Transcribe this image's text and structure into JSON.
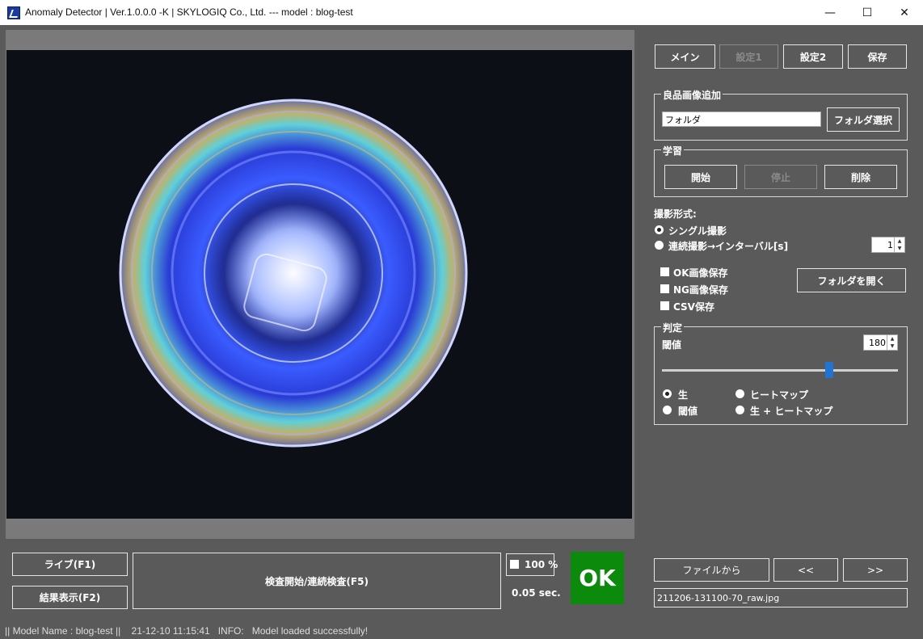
{
  "window": {
    "title": "Anomaly Detector | Ver.1.0.0.0 -K | SKYLOGIQ Co., Ltd. --- model : blog-test",
    "minimize": "—",
    "maximize": "☐",
    "close": "✕"
  },
  "top_buttons": {
    "main": "メイン",
    "settings1": "設定1",
    "settings2": "設定2",
    "save": "保存"
  },
  "good_image_add": {
    "title": "良品画像追加",
    "folder_value": "フォルダ",
    "select_folder": "フォルダ選択"
  },
  "learning": {
    "title": "学習",
    "start": "開始",
    "stop": "停止",
    "delete": "削除"
  },
  "capture": {
    "title": "撮影形式:",
    "single": "シングル撮影",
    "continuous": "連続撮影→インターバル[s]",
    "interval_value": "1"
  },
  "save_options": {
    "ok_save": "OK画像保存",
    "ng_save": "NG画像保存",
    "csv_save": "CSV保存",
    "open_folder": "フォルダを開く"
  },
  "judgement": {
    "title": "判定",
    "threshold_label": "閾値",
    "threshold_value": "180",
    "slider_fraction": 0.71,
    "view_raw": "生",
    "view_heatmap": "ヒートマップ",
    "view_threshold": "閾値",
    "view_raw_heatmap": "生 + ヒートマップ"
  },
  "bottom": {
    "live": "ライブ(F1)",
    "result": "結果表示(F2)",
    "inspect": "検査開始/連続検査(F5)",
    "zoom": "100 %",
    "time": "0.05 sec.",
    "result_badge": "OK",
    "from_file": "ファイルから",
    "prev": "<<",
    "next": ">>",
    "filename": "211206-131100-70_raw.jpg"
  },
  "status": {
    "text": "|| Model Name : blog-test ||    21-12-10 11:15:41   INFO:   Model loaded successfully!"
  },
  "colors": {
    "background": "#5a5a5a",
    "ok_green": "#0b8a0b",
    "slider_thumb": "#1f74d6"
  }
}
